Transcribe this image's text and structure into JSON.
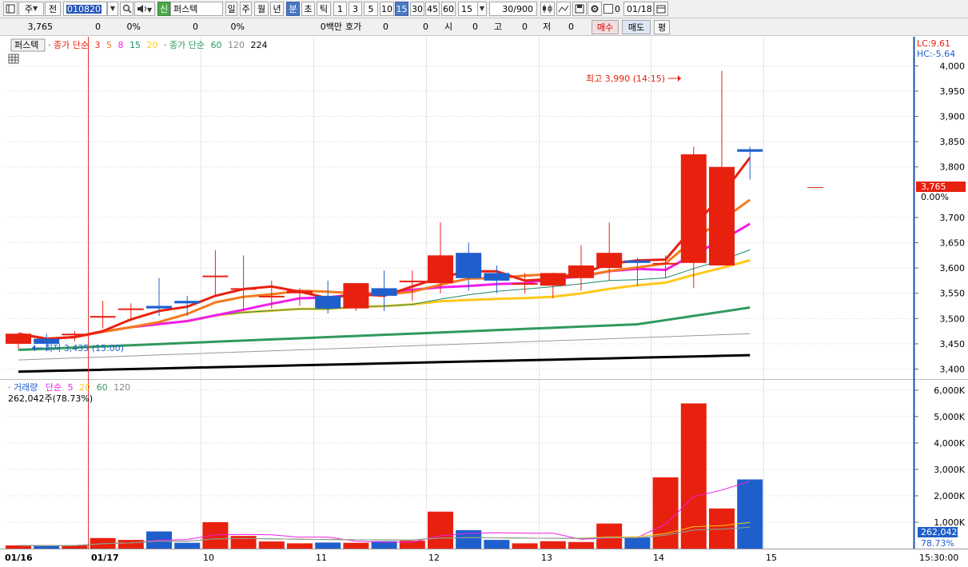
{
  "toolbar": {
    "period_select": "주",
    "prev_label": "전",
    "stock_code": "010820",
    "sin_badge": "신",
    "stock_name": "퍼스텍",
    "period_buttons": [
      "일",
      "주",
      "월",
      "년",
      "분",
      "초",
      "틱"
    ],
    "active_period": "분",
    "interval_buttons": [
      "1",
      "3",
      "5",
      "10",
      "15",
      "30",
      "45",
      "60"
    ],
    "active_interval": "15",
    "interval_select": "15",
    "count_value": "30",
    "count_total": "/900",
    "date_value": "01/18",
    "checkbox_label": "0"
  },
  "quote_bar": {
    "price": "3,765",
    "change": "0",
    "change_pct": "0%",
    "volume": "0",
    "volume_pct": "0%",
    "amount_unit": "0백만",
    "hoga_label": "호가",
    "hoga_value": "0",
    "hoga_value2": "0",
    "open_label": "시",
    "open_value": "0",
    "high_label": "고",
    "high_value": "0",
    "low_label": "저",
    "low_value": "0",
    "buy_button": "매수",
    "sell_button": "매도",
    "eval_button": "평"
  },
  "price_panel": {
    "tab_label": "퍼스텍",
    "legend_main": "종가 단순",
    "legend_periods": [
      "3",
      "5",
      "8",
      "15",
      "20"
    ],
    "legend_main2": "종가 단순",
    "legend_periods2": [
      "60",
      "120",
      "224"
    ],
    "lc_label": "LC:9.61",
    "hc_label": "HC:-5.64",
    "high_annotation": "최고 3,990 (14:15)",
    "low_annotation": "최저 3,435 (15:00)",
    "current_price_label": "3,765",
    "current_pct_label": "0.00%",
    "y_ticks": [
      "4,000",
      "3,950",
      "3,900",
      "3,850",
      "3,800",
      "3,700",
      "3,650",
      "3,600",
      "3,550",
      "3,500",
      "3,450",
      "3,400"
    ]
  },
  "volume_panel": {
    "legend_main": "거래량",
    "legend_sub": "단순",
    "legend_periods": [
      "5",
      "20",
      "60",
      "120"
    ],
    "volume_value": "262,042주(78.73%)",
    "current_volume_label": "262,042",
    "current_pct_label": "78.73%",
    "y_ticks": [
      "6,000K",
      "5,000K",
      "4,000K",
      "3,000K",
      "2,000K",
      "1,000K"
    ]
  },
  "x_axis": {
    "labels": [
      "01/16",
      "01/17",
      "10",
      "11",
      "12",
      "13",
      "14",
      "15"
    ],
    "end_time": "15:30:00"
  },
  "colors": {
    "up": "#e8210f",
    "down": "#1f5fcc",
    "ma3": "#e8210f",
    "ma5": "#f57a1f",
    "ma8": "#f01ee8",
    "ma15": "#1a8a6a",
    "ma20": "#ffc81a",
    "ma60": "#2f9a5e",
    "ma120": "#999999",
    "ma224": "#000000",
    "cursor_line": "#e03030"
  },
  "chart_data": {
    "type": "candlestick",
    "interval_minutes": 15,
    "x": [
      "01/16 15:15",
      "01/17 09:00",
      "01/17 09:15",
      "01/17 09:30",
      "01/17 09:45",
      "01/17 10:00",
      "01/17 10:15",
      "01/17 10:30",
      "01/17 10:45",
      "01/17 11:00",
      "01/17 11:15",
      "01/17 11:30",
      "01/17 11:45",
      "01/17 12:00",
      "01/17 12:15",
      "01/17 12:30",
      "01/17 12:45",
      "01/17 13:00",
      "01/17 13:15",
      "01/17 13:30",
      "01/17 13:45",
      "01/17 14:00",
      "01/17 14:15",
      "01/17 14:30",
      "01/17 14:45",
      "01/17 15:00",
      "01/17 15:15"
    ],
    "open": [
      3450,
      3460,
      3470,
      3505,
      3520,
      3525,
      3535,
      3585,
      3560,
      3545,
      3550,
      3545,
      3520,
      3560,
      3575,
      3570,
      3630,
      3590,
      3570,
      3565,
      3580,
      3600,
      3615,
      3610,
      3610,
      3605,
      3835
    ],
    "high": [
      3465,
      3470,
      3475,
      3535,
      3530,
      3580,
      3545,
      3635,
      3625,
      3575,
      3560,
      3575,
      3570,
      3595,
      3595,
      3690,
      3650,
      3605,
      3590,
      3590,
      3645,
      3690,
      3620,
      3625,
      3840,
      3990,
      3840
    ],
    "low": [
      3440,
      3435,
      3455,
      3480,
      3495,
      3505,
      3505,
      3545,
      3515,
      3520,
      3525,
      3510,
      3515,
      3515,
      3535,
      3550,
      3555,
      3550,
      3550,
      3540,
      3555,
      3575,
      3565,
      3580,
      3560,
      3760,
      3775
    ],
    "close": [
      3470,
      3450,
      3470,
      3505,
      3520,
      3520,
      3530,
      3585,
      3560,
      3545,
      3555,
      3520,
      3570,
      3545,
      3575,
      3625,
      3580,
      3575,
      3570,
      3590,
      3605,
      3630,
      3610,
      3610,
      3825,
      3800,
      3830
    ],
    "volume_k": [
      120,
      110,
      120,
      400,
      330,
      650,
      220,
      1000,
      480,
      270,
      200,
      230,
      220,
      280,
      300,
      1400,
      700,
      330,
      200,
      280,
      250,
      950,
      420,
      2700,
      5500,
      1520,
      2620
    ],
    "note": "Daily session boundaries at 01/17, 10, 11, 12, 13, 14, 15 hour marks",
    "y_range": [
      3385,
      4010
    ],
    "volume_range_k": [
      0,
      6300
    ]
  }
}
